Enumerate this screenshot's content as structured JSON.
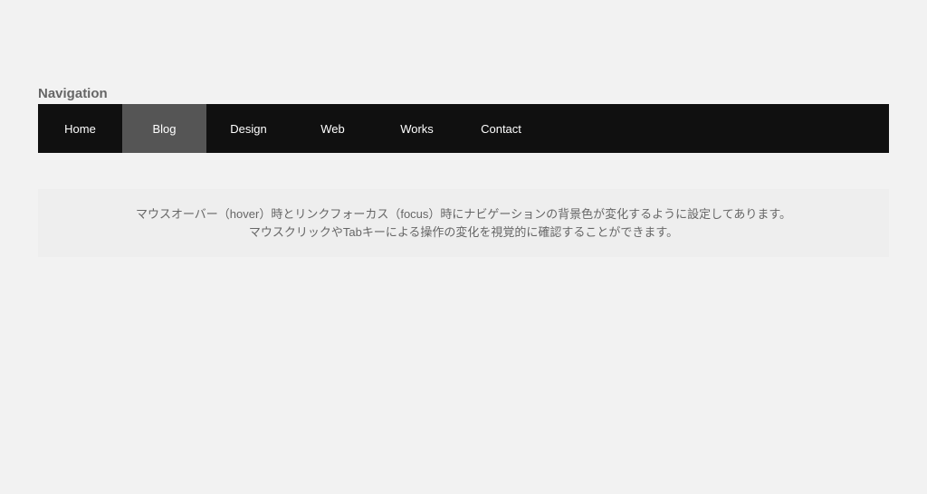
{
  "nav": {
    "title": "Navigation",
    "items": [
      {
        "label": "Home",
        "hover": false
      },
      {
        "label": "Blog",
        "hover": true
      },
      {
        "label": "Design",
        "hover": false
      },
      {
        "label": "Web",
        "hover": false
      },
      {
        "label": "Works",
        "hover": false
      },
      {
        "label": "Contact",
        "hover": false
      }
    ]
  },
  "info": {
    "line1": "マウスオーバー（hover）時とリンクフォーカス（focus）時にナビゲーションの背景色が変化するように設定してあります。",
    "line2": "マウスクリックやTabキーによる操作の変化を視覚的に確認することができます。"
  }
}
